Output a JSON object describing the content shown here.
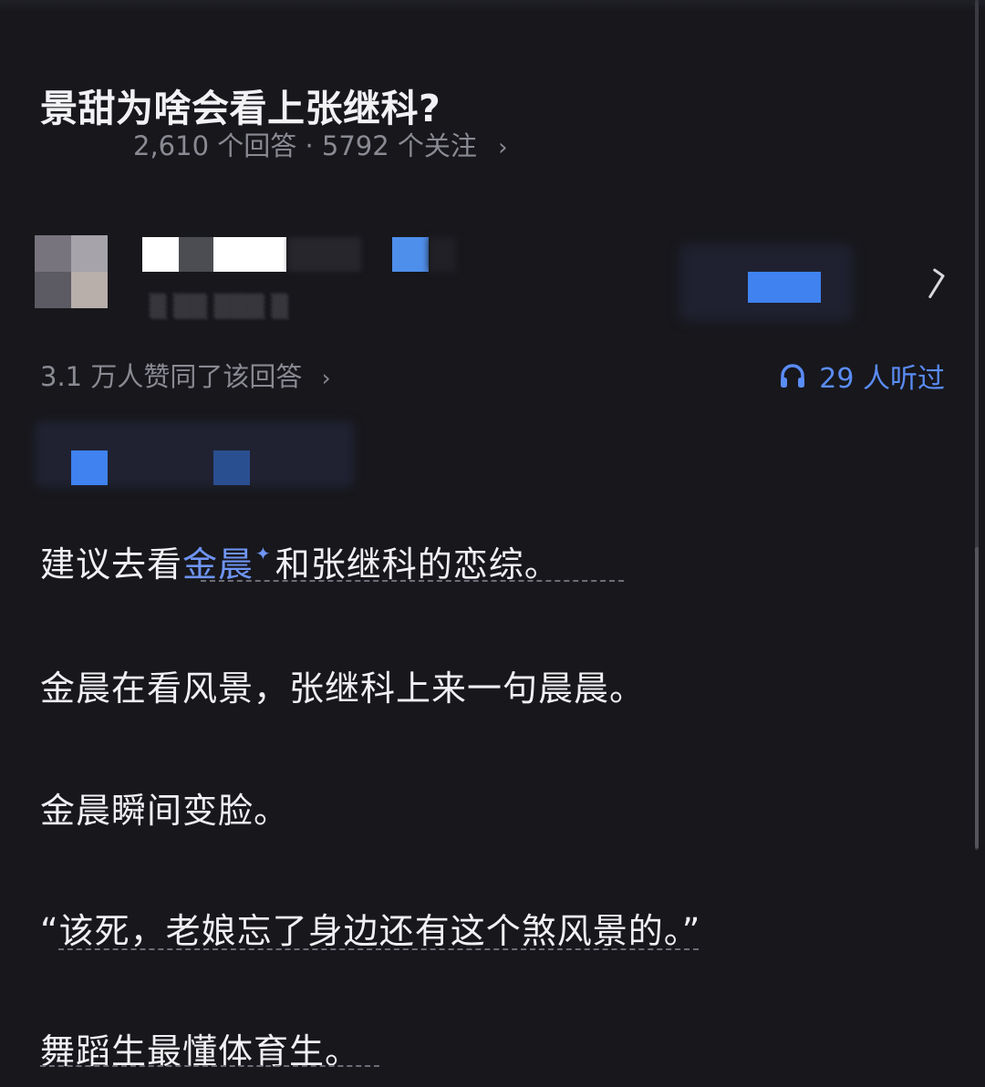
{
  "question": {
    "title": "景甜为啥会看上张继科?",
    "answers_count": "2,610 个回答",
    "separator": "·",
    "followers_count": "5792 个关注"
  },
  "answer": {
    "likes_text": "3.1 万人赞同了该回答",
    "listen_text": "29 人听过",
    "accent_color": "#5a8cf5",
    "paragraphs": {
      "p1_before": "建议去看",
      "p1_link": "金晨",
      "p1_after": "和张继科的恋综。",
      "p2": "金晨在看风景，张继科上来一句晨晨。",
      "p3": "金晨瞬间变脸。",
      "p4": "“该死，老娘忘了身边还有这个煞风景的。”",
      "p5": "舞蹈生最懂体育生。"
    }
  },
  "icons": {
    "chevron": "›",
    "sparkle": "✦",
    "more": "〉"
  }
}
